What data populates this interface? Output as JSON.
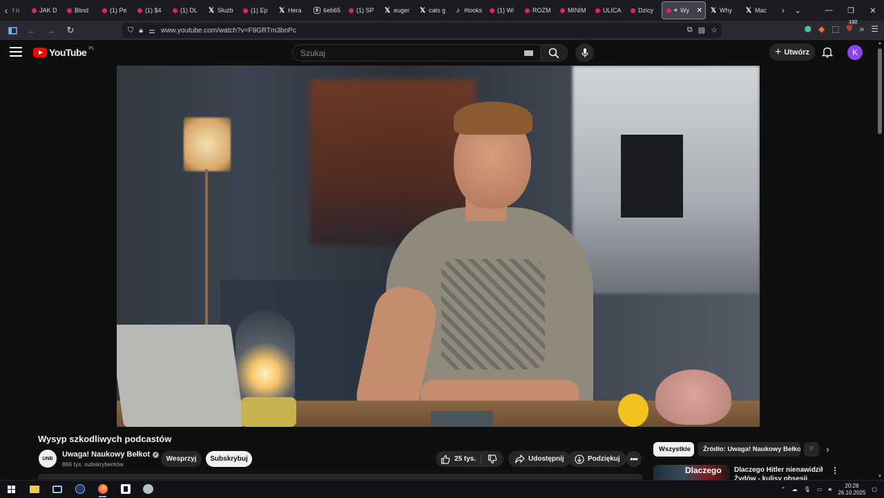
{
  "browser": {
    "tabs": [
      {
        "label": "JAK D",
        "icon": "youtube-icon"
      },
      {
        "label": "Blind",
        "icon": "youtube-icon"
      },
      {
        "label": "(1) Pe",
        "icon": "youtube-icon"
      },
      {
        "label": "(1) $4",
        "icon": "youtube-icon"
      },
      {
        "label": "(1) DL",
        "icon": "youtube-icon"
      },
      {
        "label": "Służb",
        "icon": "x-icon"
      },
      {
        "label": "(1) Ep",
        "icon": "youtube-icon"
      },
      {
        "label": "Hera",
        "icon": "x-icon"
      },
      {
        "label": "6eb65",
        "icon": "generic-icon"
      },
      {
        "label": "(1) SP",
        "icon": "youtube-icon"
      },
      {
        "label": "euger",
        "icon": "x-icon"
      },
      {
        "label": "cats g",
        "icon": "x-icon"
      },
      {
        "label": "#looks",
        "icon": "tiktok-icon"
      },
      {
        "label": "(1) Wi",
        "icon": "youtube-icon"
      },
      {
        "label": "ROZM",
        "icon": "youtube-icon"
      },
      {
        "label": "MINIM",
        "icon": "youtube-icon"
      },
      {
        "label": "ULICA",
        "icon": "youtube-icon"
      },
      {
        "label": "Dzicy",
        "icon": "youtube-icon"
      },
      {
        "label": "Wy",
        "icon": "youtube-icon",
        "active": true
      },
      {
        "label": "Why",
        "icon": "x-icon"
      },
      {
        "label": "Mac",
        "icon": "x-icon"
      }
    ],
    "first_tab_fragment": "t n",
    "url": "www.youtube.com/watch?v=F9GRTm3bnPc",
    "extensions_badge": "132"
  },
  "youtube": {
    "logo_text": "YouTube",
    "country_code": "PL",
    "search_placeholder": "Szukaj",
    "create_label": "Utwórz",
    "avatar_letter": "K",
    "video_title": "Wysyp szkodliwych podcastów",
    "channel": {
      "avatar_text": "UNB",
      "name": "Uwaga! Naukowy Bełkot",
      "subscribers": "866 tys. subskrybentów",
      "support_label": "Wesprzyj",
      "subscribe_label": "Subskrybuj"
    },
    "actions": {
      "likes": "25 tys.",
      "share_label": "Udostępnij",
      "thanks_label": "Podziękuj"
    },
    "chips": [
      {
        "label": "Wszystkie",
        "selected": true
      },
      {
        "label": "Źródło: Uwaga! Naukowy Bełkot",
        "selected": false
      },
      {
        "label": "P",
        "selected": false
      }
    ],
    "recommendation": {
      "thumb_text": "Dlaczego",
      "title": "Dlaczego Hitler nienawidził Żydów - kulisy obsesji"
    }
  },
  "taskbar": {
    "time": "20:28",
    "date": "26.10.2025"
  },
  "colors": {
    "yt_red": "#ff0000",
    "background": "#0f0f0f",
    "avatar": "#8e44ec"
  }
}
